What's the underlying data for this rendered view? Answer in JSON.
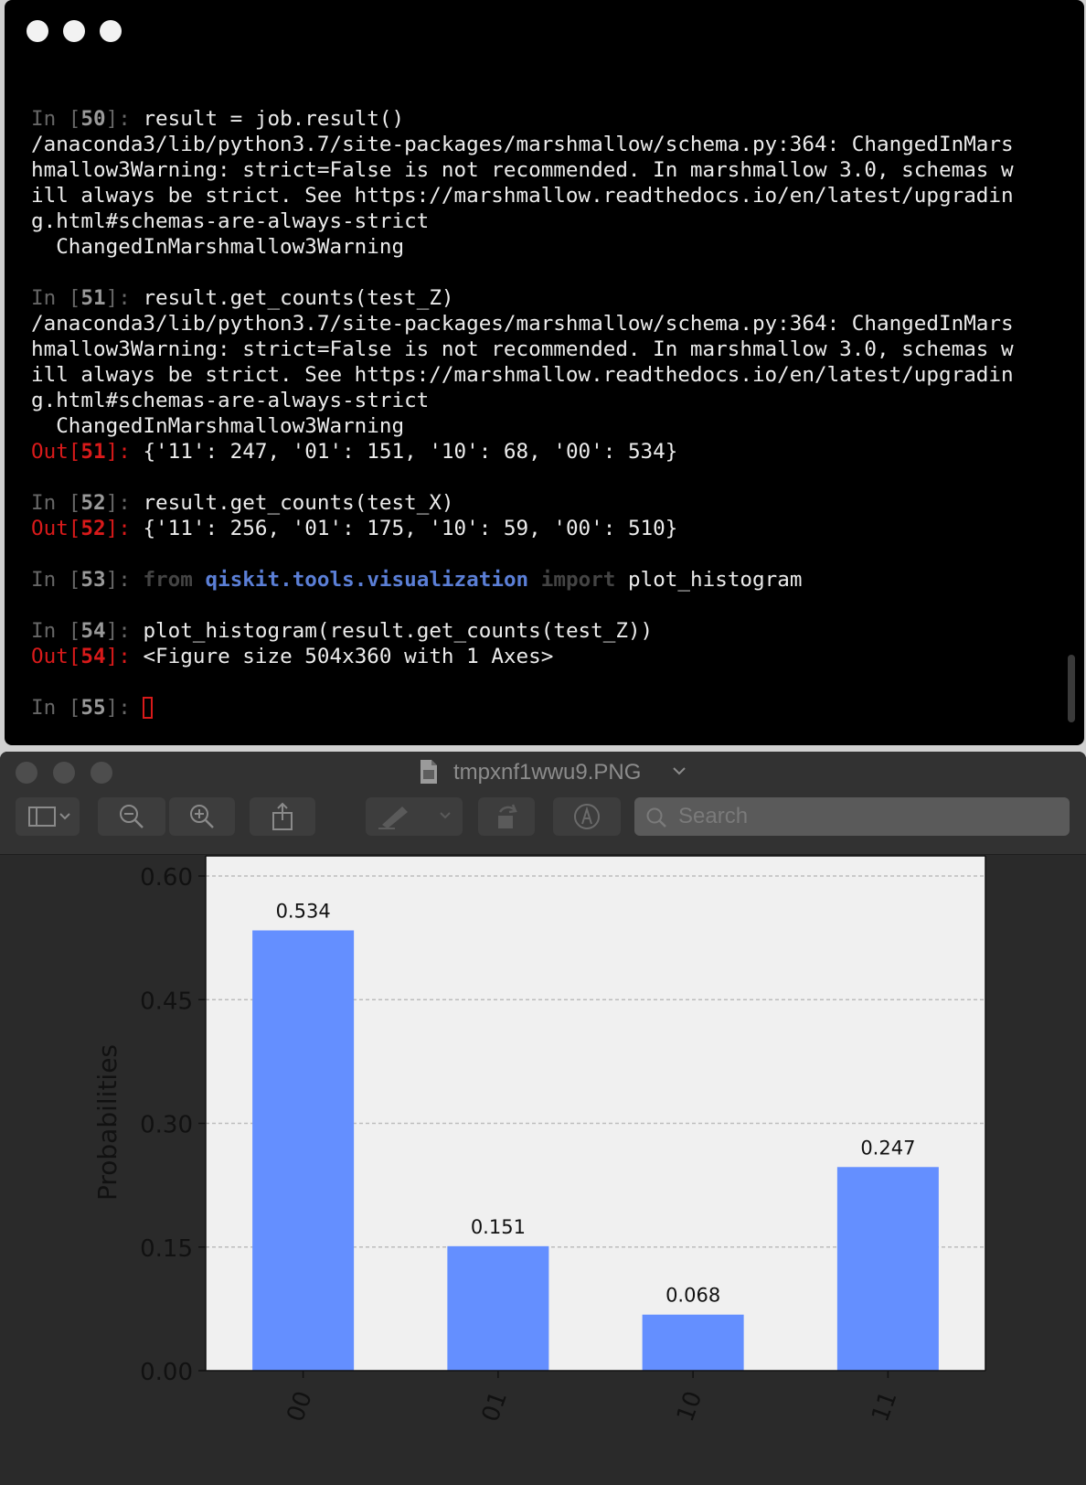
{
  "terminal": {
    "lines": [
      {
        "kind": "in",
        "n": "50",
        "code": "result = job.result()"
      },
      {
        "kind": "text",
        "text": "/anaconda3/lib/python3.7/site-packages/marshmallow/schema.py:364: ChangedInMars"
      },
      {
        "kind": "text",
        "text": "hmallow3Warning: strict=False is not recommended. In marshmallow 3.0, schemas w"
      },
      {
        "kind": "text",
        "text": "ill always be strict. See https://marshmallow.readthedocs.io/en/latest/upgradin"
      },
      {
        "kind": "text",
        "text": "g.html#schemas-are-always-strict"
      },
      {
        "kind": "text",
        "text": "  ChangedInMarshmallow3Warning"
      },
      {
        "kind": "gap"
      },
      {
        "kind": "in",
        "n": "51",
        "code": "result.get_counts(test_Z)"
      },
      {
        "kind": "text",
        "text": "/anaconda3/lib/python3.7/site-packages/marshmallow/schema.py:364: ChangedInMars"
      },
      {
        "kind": "text",
        "text": "hmallow3Warning: strict=False is not recommended. In marshmallow 3.0, schemas w"
      },
      {
        "kind": "text",
        "text": "ill always be strict. See https://marshmallow.readthedocs.io/en/latest/upgradin"
      },
      {
        "kind": "text",
        "text": "g.html#schemas-are-always-strict"
      },
      {
        "kind": "text",
        "text": "  ChangedInMarshmallow3Warning"
      },
      {
        "kind": "out",
        "n": "51",
        "code": "{'11': 247, '01': 151, '10': 68, '00': 534}"
      },
      {
        "kind": "gap"
      },
      {
        "kind": "in",
        "n": "52",
        "code": "result.get_counts(test_X)"
      },
      {
        "kind": "out",
        "n": "52",
        "code": "{'11': 256, '01': 175, '10': 59, '00': 510}"
      },
      {
        "kind": "gap"
      },
      {
        "kind": "import",
        "n": "53",
        "from": "from",
        "module": "qiskit.tools.visualization",
        "imp": "import",
        "name": "plot_histogram"
      },
      {
        "kind": "gap"
      },
      {
        "kind": "in",
        "n": "54",
        "code": "plot_histogram(result.get_counts(test_Z))"
      },
      {
        "kind": "out",
        "n": "54",
        "code": "<Figure size 504x360 with 1 Axes>"
      },
      {
        "kind": "gap"
      },
      {
        "kind": "prompt",
        "n": "55"
      }
    ]
  },
  "preview": {
    "title": "tmpxnf1wwu9.PNG",
    "search_placeholder": "Search"
  },
  "chart_data": {
    "type": "bar",
    "categories": [
      "00",
      "01",
      "10",
      "11"
    ],
    "values": [
      0.534,
      0.151,
      0.068,
      0.247
    ],
    "value_labels": [
      "0.534",
      "0.151",
      "0.068",
      "0.247"
    ],
    "ylabel": "Probabilities",
    "ylim": [
      0,
      0.63
    ],
    "yticks": [
      0.0,
      0.15,
      0.3,
      0.45,
      0.6
    ],
    "ytick_labels": [
      "0.00",
      "0.15",
      "0.30",
      "0.45",
      "0.60"
    ],
    "bar_color": "#648fff",
    "plot_bg": "#f0f0f0",
    "grid": true
  }
}
